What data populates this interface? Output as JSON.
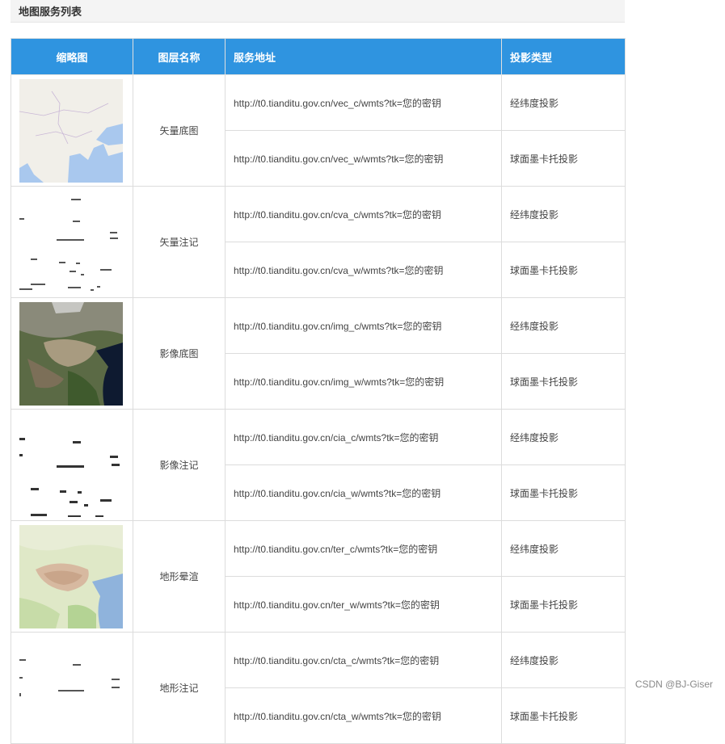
{
  "page": {
    "title": "地图服务列表"
  },
  "table": {
    "headers": [
      "缩略图",
      "图层名称",
      "服务地址",
      "投影类型"
    ],
    "rows": [
      {
        "name": "矢量底图",
        "thumb": "vector-basemap-thumbnail",
        "services": [
          {
            "url": "http://t0.tianditu.gov.cn/vec_c/wmts?tk=您的密钥",
            "proj": "经纬度投影"
          },
          {
            "url": "http://t0.tianditu.gov.cn/vec_w/wmts?tk=您的密钥",
            "proj": "球面墨卡托投影"
          }
        ]
      },
      {
        "name": "矢量注记",
        "thumb": "vector-annotation-thumbnail",
        "services": [
          {
            "url": "http://t0.tianditu.gov.cn/cva_c/wmts?tk=您的密钥",
            "proj": "经纬度投影"
          },
          {
            "url": "http://t0.tianditu.gov.cn/cva_w/wmts?tk=您的密钥",
            "proj": "球面墨卡托投影"
          }
        ]
      },
      {
        "name": "影像底图",
        "thumb": "imagery-basemap-thumbnail",
        "services": [
          {
            "url": "http://t0.tianditu.gov.cn/img_c/wmts?tk=您的密钥",
            "proj": "经纬度投影"
          },
          {
            "url": "http://t0.tianditu.gov.cn/img_w/wmts?tk=您的密钥",
            "proj": "球面墨卡托投影"
          }
        ]
      },
      {
        "name": "影像注记",
        "thumb": "imagery-annotation-thumbnail",
        "services": [
          {
            "url": "http://t0.tianditu.gov.cn/cia_c/wmts?tk=您的密钥",
            "proj": "经纬度投影"
          },
          {
            "url": "http://t0.tianditu.gov.cn/cia_w/wmts?tk=您的密钥",
            "proj": "球面墨卡托投影"
          }
        ]
      },
      {
        "name": "地形晕渲",
        "thumb": "terrain-hillshade-thumbnail",
        "services": [
          {
            "url": "http://t0.tianditu.gov.cn/ter_c/wmts?tk=您的密钥",
            "proj": "经纬度投影"
          },
          {
            "url": "http://t0.tianditu.gov.cn/ter_w/wmts?tk=您的密钥",
            "proj": "球面墨卡托投影"
          }
        ]
      },
      {
        "name": "地形注记",
        "thumb": "terrain-annotation-thumbnail",
        "services": [
          {
            "url": "http://t0.tianditu.gov.cn/cta_c/wmts?tk=您的密钥",
            "proj": "经纬度投影"
          },
          {
            "url": "http://t0.tianditu.gov.cn/cta_w/wmts?tk=您的密钥",
            "proj": "球面墨卡托投影"
          }
        ]
      }
    ]
  },
  "watermark": "CSDN @BJ-Giser",
  "colors": {
    "header_bg": "#2f94e0",
    "header_text": "#ffffff",
    "border": "#dcdcdc"
  }
}
